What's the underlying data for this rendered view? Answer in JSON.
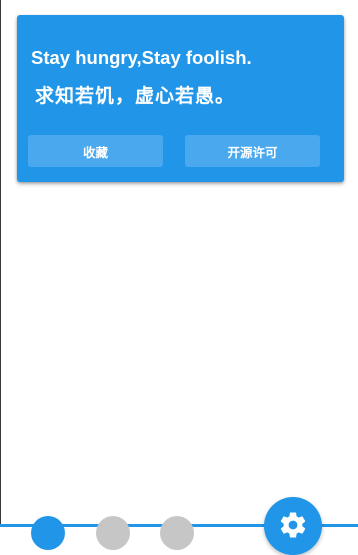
{
  "card": {
    "quote_en": "Stay hungry,Stay foolish.",
    "quote_cn": "求知若饥，虚心若愚。",
    "collect_label": "收藏",
    "license_label": "开源许可"
  },
  "pager": {
    "page_count": 3,
    "active_index": 0
  },
  "fab": {
    "icon": "gear-icon"
  },
  "colors": {
    "accent": "#2196e8",
    "button_bg": "#4aa8ee",
    "inactive_dot": "#c6c6c6"
  }
}
